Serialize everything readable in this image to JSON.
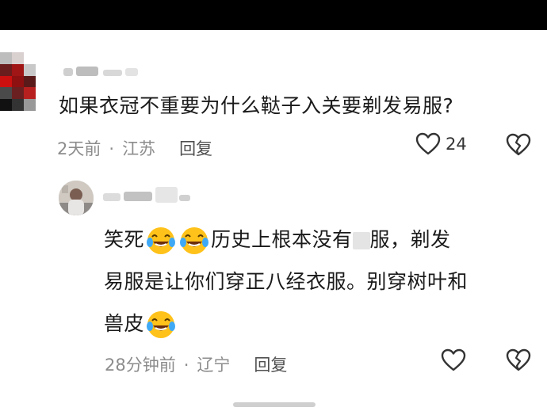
{
  "comment": {
    "text": "如果衣冠不重要为什么鞑子入关要剃发易服?",
    "time": "2天前",
    "location": "江苏",
    "reply_label": "回复",
    "likes": "24"
  },
  "reply": {
    "line1_a": "笑死",
    "line1_b": "历史上根本没有",
    "line1_c": "服，剃发",
    "line2": "易服是让你们穿正八经衣服。别穿树叶和",
    "line3": "兽皮",
    "time": "28分钟前",
    "location": "辽宁",
    "reply_label": "回复"
  },
  "icons": {
    "like": "heart-outline-icon",
    "dislike": "broken-heart-icon",
    "emoji": "laughing-tears-emoji"
  },
  "colors": {
    "meta_gray": "#8c8c8c",
    "emoji_yellow": "#ffc21a"
  }
}
